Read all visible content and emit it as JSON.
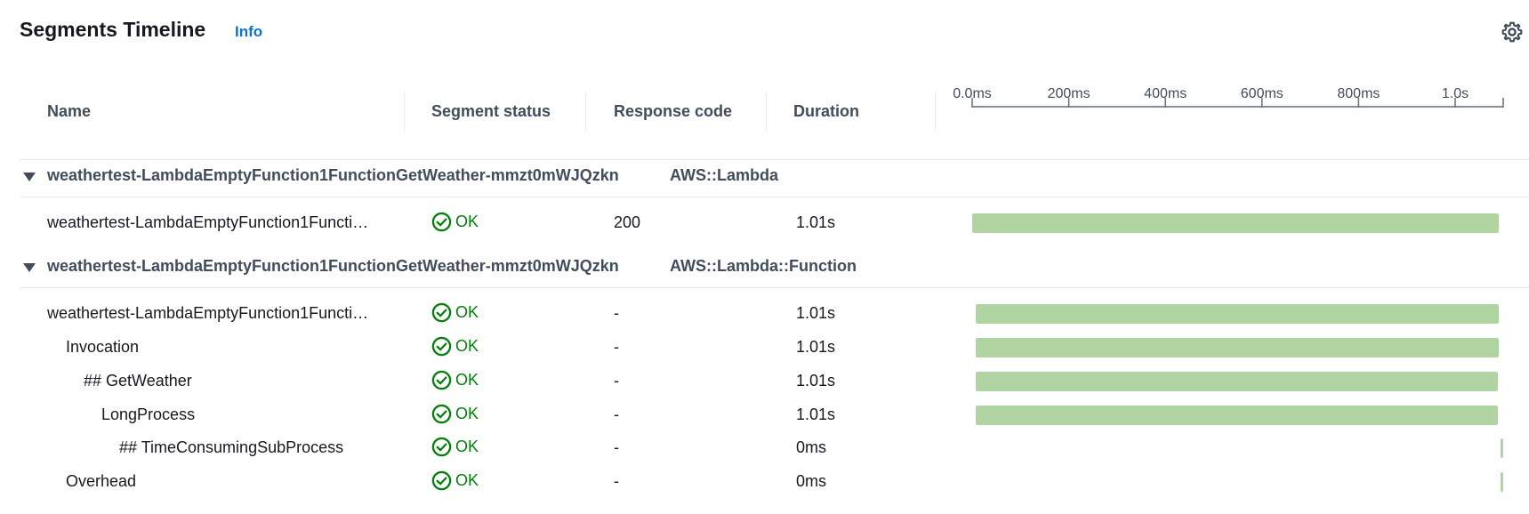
{
  "header": {
    "title": "Segments Timeline",
    "info_label": "Info"
  },
  "columns": {
    "name": "Name",
    "status": "Segment status",
    "code": "Response code",
    "duration": "Duration"
  },
  "axis": {
    "ticks": [
      "0.0ms",
      "200ms",
      "400ms",
      "600ms",
      "800ms",
      "1.0s"
    ]
  },
  "groups": [
    {
      "name": "weathertest-LambdaEmptyFunction1FunctionGetWeather-mmzt0mWJQzkn",
      "type": "AWS::Lambda",
      "rows": [
        {
          "name": "weathertest-LambdaEmptyFunction1Functi…",
          "status": "OK",
          "code": "200",
          "duration": "1.01s",
          "bar_start_ms": 0,
          "bar_duration_ms": 1010
        }
      ]
    },
    {
      "name": "weathertest-LambdaEmptyFunction1FunctionGetWeather-mmzt0mWJQzkn",
      "type": "AWS::Lambda::Function",
      "rows": [
        {
          "name": "weathertest-LambdaEmptyFunction1Functi…",
          "status": "OK",
          "code": "-",
          "duration": "1.01s",
          "bar_start_ms": 7,
          "bar_duration_ms": 1003
        },
        {
          "name": "Invocation",
          "status": "OK",
          "code": "-",
          "duration": "1.01s",
          "bar_start_ms": 7,
          "bar_duration_ms": 1003
        },
        {
          "name": "## GetWeather",
          "status": "OK",
          "code": "-",
          "duration": "1.01s",
          "bar_start_ms": 7,
          "bar_duration_ms": 1001
        },
        {
          "name": "LongProcess",
          "status": "OK",
          "code": "-",
          "duration": "1.01s",
          "bar_start_ms": 7,
          "bar_duration_ms": 1001
        },
        {
          "name": "## TimeConsumingSubProcess",
          "status": "OK",
          "code": "-",
          "duration": "0ms",
          "bar_start_ms": 1009,
          "bar_duration_ms": 1
        },
        {
          "name": "Overhead",
          "status": "OK",
          "code": "-",
          "duration": "0ms",
          "bar_start_ms": 1009,
          "bar_duration_ms": 1
        }
      ]
    }
  ],
  "colors": {
    "bar": "#b0d5a3",
    "ok": "#037f0c",
    "link": "#0972d3"
  }
}
